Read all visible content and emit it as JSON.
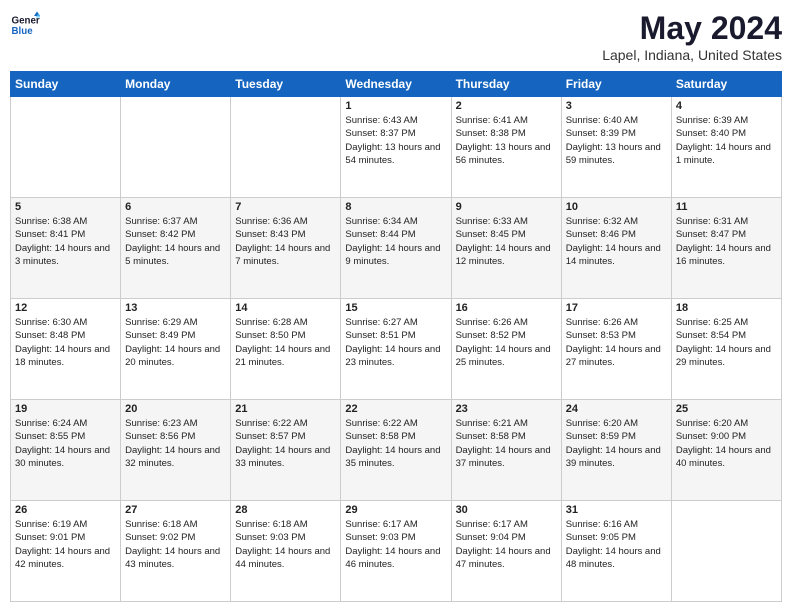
{
  "logo": {
    "line1": "General",
    "line2": "Blue"
  },
  "title": "May 2024",
  "location": "Lapel, Indiana, United States",
  "days_header": [
    "Sunday",
    "Monday",
    "Tuesday",
    "Wednesday",
    "Thursday",
    "Friday",
    "Saturday"
  ],
  "weeks": [
    [
      {
        "day": "",
        "sunrise": "",
        "sunset": "",
        "daylight": ""
      },
      {
        "day": "",
        "sunrise": "",
        "sunset": "",
        "daylight": ""
      },
      {
        "day": "",
        "sunrise": "",
        "sunset": "",
        "daylight": ""
      },
      {
        "day": "1",
        "sunrise": "Sunrise: 6:43 AM",
        "sunset": "Sunset: 8:37 PM",
        "daylight": "Daylight: 13 hours and 54 minutes."
      },
      {
        "day": "2",
        "sunrise": "Sunrise: 6:41 AM",
        "sunset": "Sunset: 8:38 PM",
        "daylight": "Daylight: 13 hours and 56 minutes."
      },
      {
        "day": "3",
        "sunrise": "Sunrise: 6:40 AM",
        "sunset": "Sunset: 8:39 PM",
        "daylight": "Daylight: 13 hours and 59 minutes."
      },
      {
        "day": "4",
        "sunrise": "Sunrise: 6:39 AM",
        "sunset": "Sunset: 8:40 PM",
        "daylight": "Daylight: 14 hours and 1 minute."
      }
    ],
    [
      {
        "day": "5",
        "sunrise": "Sunrise: 6:38 AM",
        "sunset": "Sunset: 8:41 PM",
        "daylight": "Daylight: 14 hours and 3 minutes."
      },
      {
        "day": "6",
        "sunrise": "Sunrise: 6:37 AM",
        "sunset": "Sunset: 8:42 PM",
        "daylight": "Daylight: 14 hours and 5 minutes."
      },
      {
        "day": "7",
        "sunrise": "Sunrise: 6:36 AM",
        "sunset": "Sunset: 8:43 PM",
        "daylight": "Daylight: 14 hours and 7 minutes."
      },
      {
        "day": "8",
        "sunrise": "Sunrise: 6:34 AM",
        "sunset": "Sunset: 8:44 PM",
        "daylight": "Daylight: 14 hours and 9 minutes."
      },
      {
        "day": "9",
        "sunrise": "Sunrise: 6:33 AM",
        "sunset": "Sunset: 8:45 PM",
        "daylight": "Daylight: 14 hours and 12 minutes."
      },
      {
        "day": "10",
        "sunrise": "Sunrise: 6:32 AM",
        "sunset": "Sunset: 8:46 PM",
        "daylight": "Daylight: 14 hours and 14 minutes."
      },
      {
        "day": "11",
        "sunrise": "Sunrise: 6:31 AM",
        "sunset": "Sunset: 8:47 PM",
        "daylight": "Daylight: 14 hours and 16 minutes."
      }
    ],
    [
      {
        "day": "12",
        "sunrise": "Sunrise: 6:30 AM",
        "sunset": "Sunset: 8:48 PM",
        "daylight": "Daylight: 14 hours and 18 minutes."
      },
      {
        "day": "13",
        "sunrise": "Sunrise: 6:29 AM",
        "sunset": "Sunset: 8:49 PM",
        "daylight": "Daylight: 14 hours and 20 minutes."
      },
      {
        "day": "14",
        "sunrise": "Sunrise: 6:28 AM",
        "sunset": "Sunset: 8:50 PM",
        "daylight": "Daylight: 14 hours and 21 minutes."
      },
      {
        "day": "15",
        "sunrise": "Sunrise: 6:27 AM",
        "sunset": "Sunset: 8:51 PM",
        "daylight": "Daylight: 14 hours and 23 minutes."
      },
      {
        "day": "16",
        "sunrise": "Sunrise: 6:26 AM",
        "sunset": "Sunset: 8:52 PM",
        "daylight": "Daylight: 14 hours and 25 minutes."
      },
      {
        "day": "17",
        "sunrise": "Sunrise: 6:26 AM",
        "sunset": "Sunset: 8:53 PM",
        "daylight": "Daylight: 14 hours and 27 minutes."
      },
      {
        "day": "18",
        "sunrise": "Sunrise: 6:25 AM",
        "sunset": "Sunset: 8:54 PM",
        "daylight": "Daylight: 14 hours and 29 minutes."
      }
    ],
    [
      {
        "day": "19",
        "sunrise": "Sunrise: 6:24 AM",
        "sunset": "Sunset: 8:55 PM",
        "daylight": "Daylight: 14 hours and 30 minutes."
      },
      {
        "day": "20",
        "sunrise": "Sunrise: 6:23 AM",
        "sunset": "Sunset: 8:56 PM",
        "daylight": "Daylight: 14 hours and 32 minutes."
      },
      {
        "day": "21",
        "sunrise": "Sunrise: 6:22 AM",
        "sunset": "Sunset: 8:57 PM",
        "daylight": "Daylight: 14 hours and 33 minutes."
      },
      {
        "day": "22",
        "sunrise": "Sunrise: 6:22 AM",
        "sunset": "Sunset: 8:58 PM",
        "daylight": "Daylight: 14 hours and 35 minutes."
      },
      {
        "day": "23",
        "sunrise": "Sunrise: 6:21 AM",
        "sunset": "Sunset: 8:58 PM",
        "daylight": "Daylight: 14 hours and 37 minutes."
      },
      {
        "day": "24",
        "sunrise": "Sunrise: 6:20 AM",
        "sunset": "Sunset: 8:59 PM",
        "daylight": "Daylight: 14 hours and 39 minutes."
      },
      {
        "day": "25",
        "sunrise": "Sunrise: 6:20 AM",
        "sunset": "Sunset: 9:00 PM",
        "daylight": "Daylight: 14 hours and 40 minutes."
      }
    ],
    [
      {
        "day": "26",
        "sunrise": "Sunrise: 6:19 AM",
        "sunset": "Sunset: 9:01 PM",
        "daylight": "Daylight: 14 hours and 42 minutes."
      },
      {
        "day": "27",
        "sunrise": "Sunrise: 6:18 AM",
        "sunset": "Sunset: 9:02 PM",
        "daylight": "Daylight: 14 hours and 43 minutes."
      },
      {
        "day": "28",
        "sunrise": "Sunrise: 6:18 AM",
        "sunset": "Sunset: 9:03 PM",
        "daylight": "Daylight: 14 hours and 44 minutes."
      },
      {
        "day": "29",
        "sunrise": "Sunrise: 6:17 AM",
        "sunset": "Sunset: 9:03 PM",
        "daylight": "Daylight: 14 hours and 46 minutes."
      },
      {
        "day": "30",
        "sunrise": "Sunrise: 6:17 AM",
        "sunset": "Sunset: 9:04 PM",
        "daylight": "Daylight: 14 hours and 47 minutes."
      },
      {
        "day": "31",
        "sunrise": "Sunrise: 6:16 AM",
        "sunset": "Sunset: 9:05 PM",
        "daylight": "Daylight: 14 hours and 48 minutes."
      },
      {
        "day": "",
        "sunrise": "",
        "sunset": "",
        "daylight": ""
      }
    ]
  ]
}
